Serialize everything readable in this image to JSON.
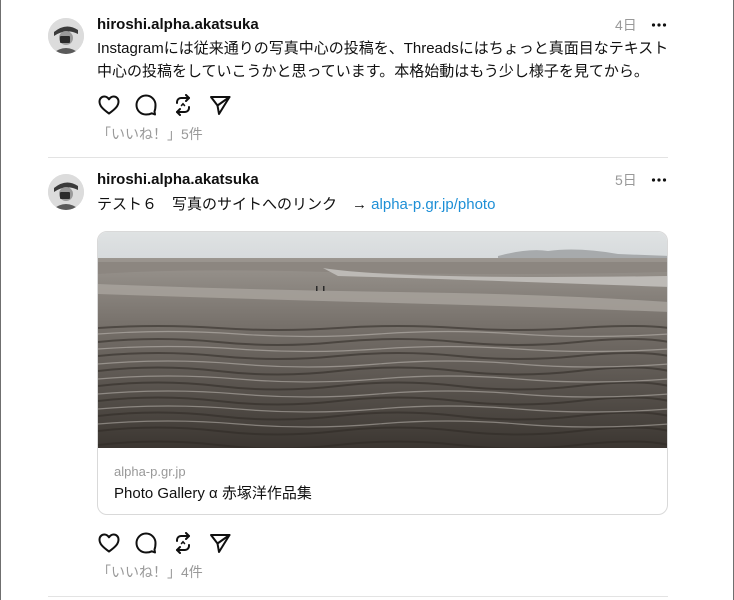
{
  "posts": [
    {
      "username": "hiroshi.alpha.akatsuka",
      "time": "4日",
      "text": "Instagramには従来通りの写真中心の投稿を、Threadsにはちょっと真面目なテキスト中心の投稿をしていこうかと思っています。本格始動はもう少し様子を見てから。",
      "likes": "「いいね！」5件"
    },
    {
      "username": "hiroshi.alpha.akatsuka",
      "time": "5日",
      "text": "テスト６　写真のサイトへのリンク　→ ",
      "link": "alpha-p.gr.jp/photo",
      "card": {
        "domain": "alpha-p.gr.jp",
        "title": "Photo Gallery α 赤塚洋作品集"
      },
      "likes": "「いいね！」4件"
    }
  ],
  "icons": {
    "avatar": "avatar-photo",
    "more": "more-horizontal-icon",
    "like": "heart-icon",
    "comment": "comment-bubble-icon",
    "repost": "repost-icon",
    "share": "send-icon"
  },
  "colors": {
    "text": "#101010",
    "muted": "#999999",
    "link": "#1d8fd6",
    "divider": "#e3e3e3"
  }
}
